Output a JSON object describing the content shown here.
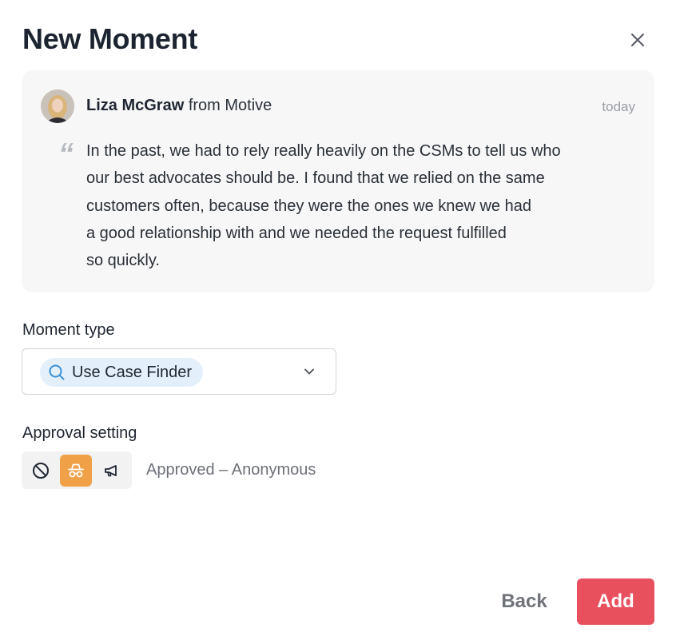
{
  "dialog": {
    "title": "New Moment"
  },
  "quote": {
    "author_name": "Liza McGraw",
    "author_company": "from Motive",
    "date": "today",
    "text_lines": [
      "In the past, we had to rely really heavily on the CSMs to tell us who",
      "our best advocates should be. I found that we relied on the same",
      "customers often, because they were the ones we knew we had",
      "a good relationship with and we needed the request fulfilled",
      "so quickly."
    ]
  },
  "moment_type": {
    "label": "Moment type",
    "selected": "Use Case Finder",
    "selected_icon": "search-icon"
  },
  "approval": {
    "label": "Approval setting",
    "options": [
      "not-approved",
      "approved-anonymous",
      "approved-public"
    ],
    "selected_index": 1,
    "status_text": "Approved – Anonymous"
  },
  "footer": {
    "back_label": "Back",
    "add_label": "Add"
  },
  "colors": {
    "accent_primary": "#e9505e",
    "approval_active": "#f0a047",
    "chip_bg": "#e3f0fb"
  }
}
